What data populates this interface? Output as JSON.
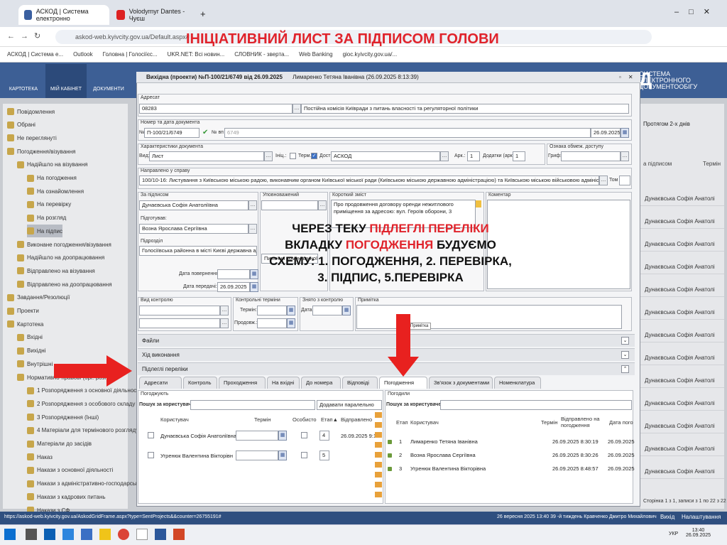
{
  "browser": {
    "tabs": [
      {
        "label": "АСКОД | Система електронно",
        "active": true
      },
      {
        "label": "Volodymyr Dantes - Чуєш",
        "active": false
      }
    ],
    "url": "askod-web.kyivcity.gov.ua/Default.aspx#",
    "bookmarks": [
      "АСКОД | Система е...",
      "Outlook",
      "Головна | Голосіїєс...",
      "UKR.NET: Всі новин...",
      "СЛОВНИК - зверта...",
      "Web Banking",
      "gioc.kyivcity.gov.ua/..."
    ]
  },
  "slide": {
    "title": "ІНІЦІАТИВНИЙ ЛИСТ ЗА ПІДПИСОМ ГОЛОВИ",
    "overlay_prefix": "ЧЕРЕЗ ТЕКУ ",
    "overlay_red1": "ПІДЛЕГЛІ ПЕРЕЛІКИ",
    "overlay_mid": "ВКЛАДКУ ",
    "overlay_red2": "ПОГОДЖЕННЯ",
    "overlay_mid2": " БУДУЄМО",
    "overlay_line3": "СХЕМУ: 1. ПОГОДЖЕННЯ, 2. ПЕРЕВІРКА,",
    "overlay_line4": "3. ПІДПИС, 5.ПЕРЕВІРКА"
  },
  "app": {
    "nav": [
      "КАРТОТЕКА",
      "МІЙ КАБІНЕТ",
      "ДОКУМЕНТИ"
    ],
    "logo": [
      "СИСТЕМА",
      "ЕЛЕКТРОННОГО",
      "ДОКУМЕНТООБІГУ"
    ],
    "logo_big": "ОД",
    "sidebar": [
      "Повідомлення",
      "Обрані",
      "Не переглянуті",
      "Погодження/візування",
      "Надійшло на візування",
      "На погодження",
      "На ознайомлення",
      "На перевірку",
      "На розгляд",
      "На підпис",
      "Виконане погодження/візування",
      "Надійшло на доопрацювання",
      "Відправлено на візування",
      "Відправлено на доопрацювання",
      "Завдання/Резолюції",
      "Проекти",
      "Картотека",
      "Вхідні",
      "Вихідні",
      "Внутрішні",
      "Нормативно-правові (орг.-розп.)",
      "1 Розпорядження з основної діяльності",
      "2 Розпорядження з особового складу",
      "3 Розпорядження (Інші)",
      "4 Матеріали для термінового розгляду",
      "Матеріали до засідів",
      "Наказ",
      "Накази з основної діяльності",
      "Накази з адміністративно-господарських",
      "Накази з кадрових питань",
      "Накази з СФ"
    ],
    "right_panel": {
      "filter": "Протягом 2-х днів",
      "header1": "а підписом",
      "header2": "Термін",
      "rows": [
        "Дунаєвська Софія Анатолі",
        "Дунаєвська Софія Анатолі",
        "Дунаєвська Софія Анатолі",
        "Дунаєвська Софія Анатолі",
        "Дунаєвська Софія Анатолі",
        "Дунаєвська Софія Анатолі",
        "Дунаєвська Софія Анатолі",
        "Дунаєвська Софія Анатолі",
        "Дунаєвська Софія Анатолі",
        "Дунаєвська Софія Анатолі",
        "Дунаєвська Софія Анатолі",
        "Дунаєвська Софія Анатолі",
        "Дунаєвська Софія Анатолі"
      ],
      "pager": "Сторінка 1 з 1, записи з 1 по 22 з 22"
    },
    "status_url": "https://askod-web.kyivcity.gov.ua/AskodGridFrame.aspx?type=SentProjects&&counter=26755191#",
    "status_right": "26 вересня 2025 13:40  39 -й тиждень  Кравченко Дмитро Михайлович",
    "status_exit": "Вихід",
    "status_settings": "Налаштування",
    "taskbar_time": "13:40",
    "taskbar_date": "26.09.2025",
    "taskbar_lang": "УКР"
  },
  "dialog": {
    "title": "Вихідна (проекти) №П-100/21/6749 від 26.09.2025",
    "author": "Лимаренко Тетяна Іванівна (26.09.2025 8:13:39)",
    "adresat_label": "Адресат",
    "adresat_code": "08283",
    "adresat_name": "Постійна комісія Київради з питань власності та регуляторної політики",
    "number_label": "Номер та дата документа",
    "number_prefix": "№",
    "number_value": "П-100/21/6749",
    "number_ext_label": "№ вп",
    "number_ext": "6749",
    "number_date": "26.09.2025",
    "char_label": "Характеристики документа",
    "vyd_label": "Вид:",
    "vyd_value": "Лист",
    "inits_label": "Ініц.:",
    "term_label": "Терм.",
    "dost_label": "Дост:",
    "dost_value": "АСКОД",
    "ark_label": "Арк.:",
    "ark_value": "1",
    "dod_label": "Додатки (арк.):",
    "dod_value": "1",
    "access_label": "Ознака обмеж. доступу",
    "grif_label": "Гриф:",
    "napr_label": "Направлено у справу",
    "napr_value": "100/10-16: Листування з Київською міською радою, виконавчим органом Київської міської ради (Київською міською державною адміністрацією) та  Київською міською військовою адміністрацією",
    "tom_label": "Том",
    "pidpys_label": "За підписом",
    "pidpys_value": "Дунаєвська Софія Анатоліївна",
    "pidgot_label": "Підготував:",
    "pidgot_value": "Возна Ярослава Сергіївна",
    "pidrozdil_label": "Підрозділ",
    "pidrozdil_value": "Голосіївська районна в місті Києві державна ад",
    "upov_label": "Уповноважений",
    "upov_value2": "Питання комунальної в",
    "zmist_label": "Короткий зміст",
    "zmist_value": "Про продовження договору оренди нежитлового приміщення за адресою: вул. Героїв оборони, 3",
    "komentar_label": "Коментар",
    "data_pov_label": "Дата повернення:",
    "data_per_label": "Дата передачі:",
    "data_per_value": "26.09.2025",
    "vyd_kontr_label": "Вид контролю",
    "kontr_term_label": "Контрольні терміни",
    "termin_label": "Термін:",
    "prodovzh_label": "Продовж.:",
    "znyato_label": "Знято з контролю",
    "data_label": "Дата:",
    "prymitka_label": "Примітка",
    "prymitka_tip": "Примітка",
    "sections": [
      "Файли",
      "Хід виконання",
      "Підлеглі переліки"
    ],
    "tabs": [
      "Адресати",
      "Контроль",
      "Проходження",
      "На вхідні",
      "До номера",
      "Відповіді",
      "Погодження",
      "Зв'язок з документами",
      "Номенклатура"
    ],
    "left_grid": {
      "title": "Погоджують",
      "search_label": "Пошук за користувачем:",
      "add_parallel": "Додавати паралельно",
      "headers": [
        "Користувач",
        "Термін",
        "Особисто",
        "Етап▲",
        "Відправлено"
      ],
      "rows": [
        {
          "user": "Дунаєвська Софія Анатоліївна",
          "etap": "4",
          "sent": "26.09.2025 9:10"
        },
        {
          "user": "Угренюк Валентина Вікторівн",
          "etap": "5",
          "sent": ""
        }
      ]
    },
    "right_grid": {
      "title": "Погодили",
      "search_label": "Пошук за користувачем:",
      "headers": [
        "Етап",
        "Користувач",
        "Термін",
        "Відправлено на погодження",
        "Дата пого"
      ],
      "rows": [
        {
          "etap": "1",
          "user": "Лимаренко Тетяна Іванівна",
          "sent": "26.09.2025 8:30:19",
          "date": "26.09.2025"
        },
        {
          "etap": "2",
          "user": "Возна Ярослава Сергіївна",
          "sent": "26.09.2025 8:30:26",
          "date": "26.09.2025"
        },
        {
          "etap": "3",
          "user": "Угренюк Валентина Вікторівна",
          "sent": "26.09.2025 8:48:57",
          "date": "26.09.2025"
        }
      ]
    }
  },
  "colors": {
    "accent_red": "#e0232b",
    "banner": "#3d5f95"
  }
}
